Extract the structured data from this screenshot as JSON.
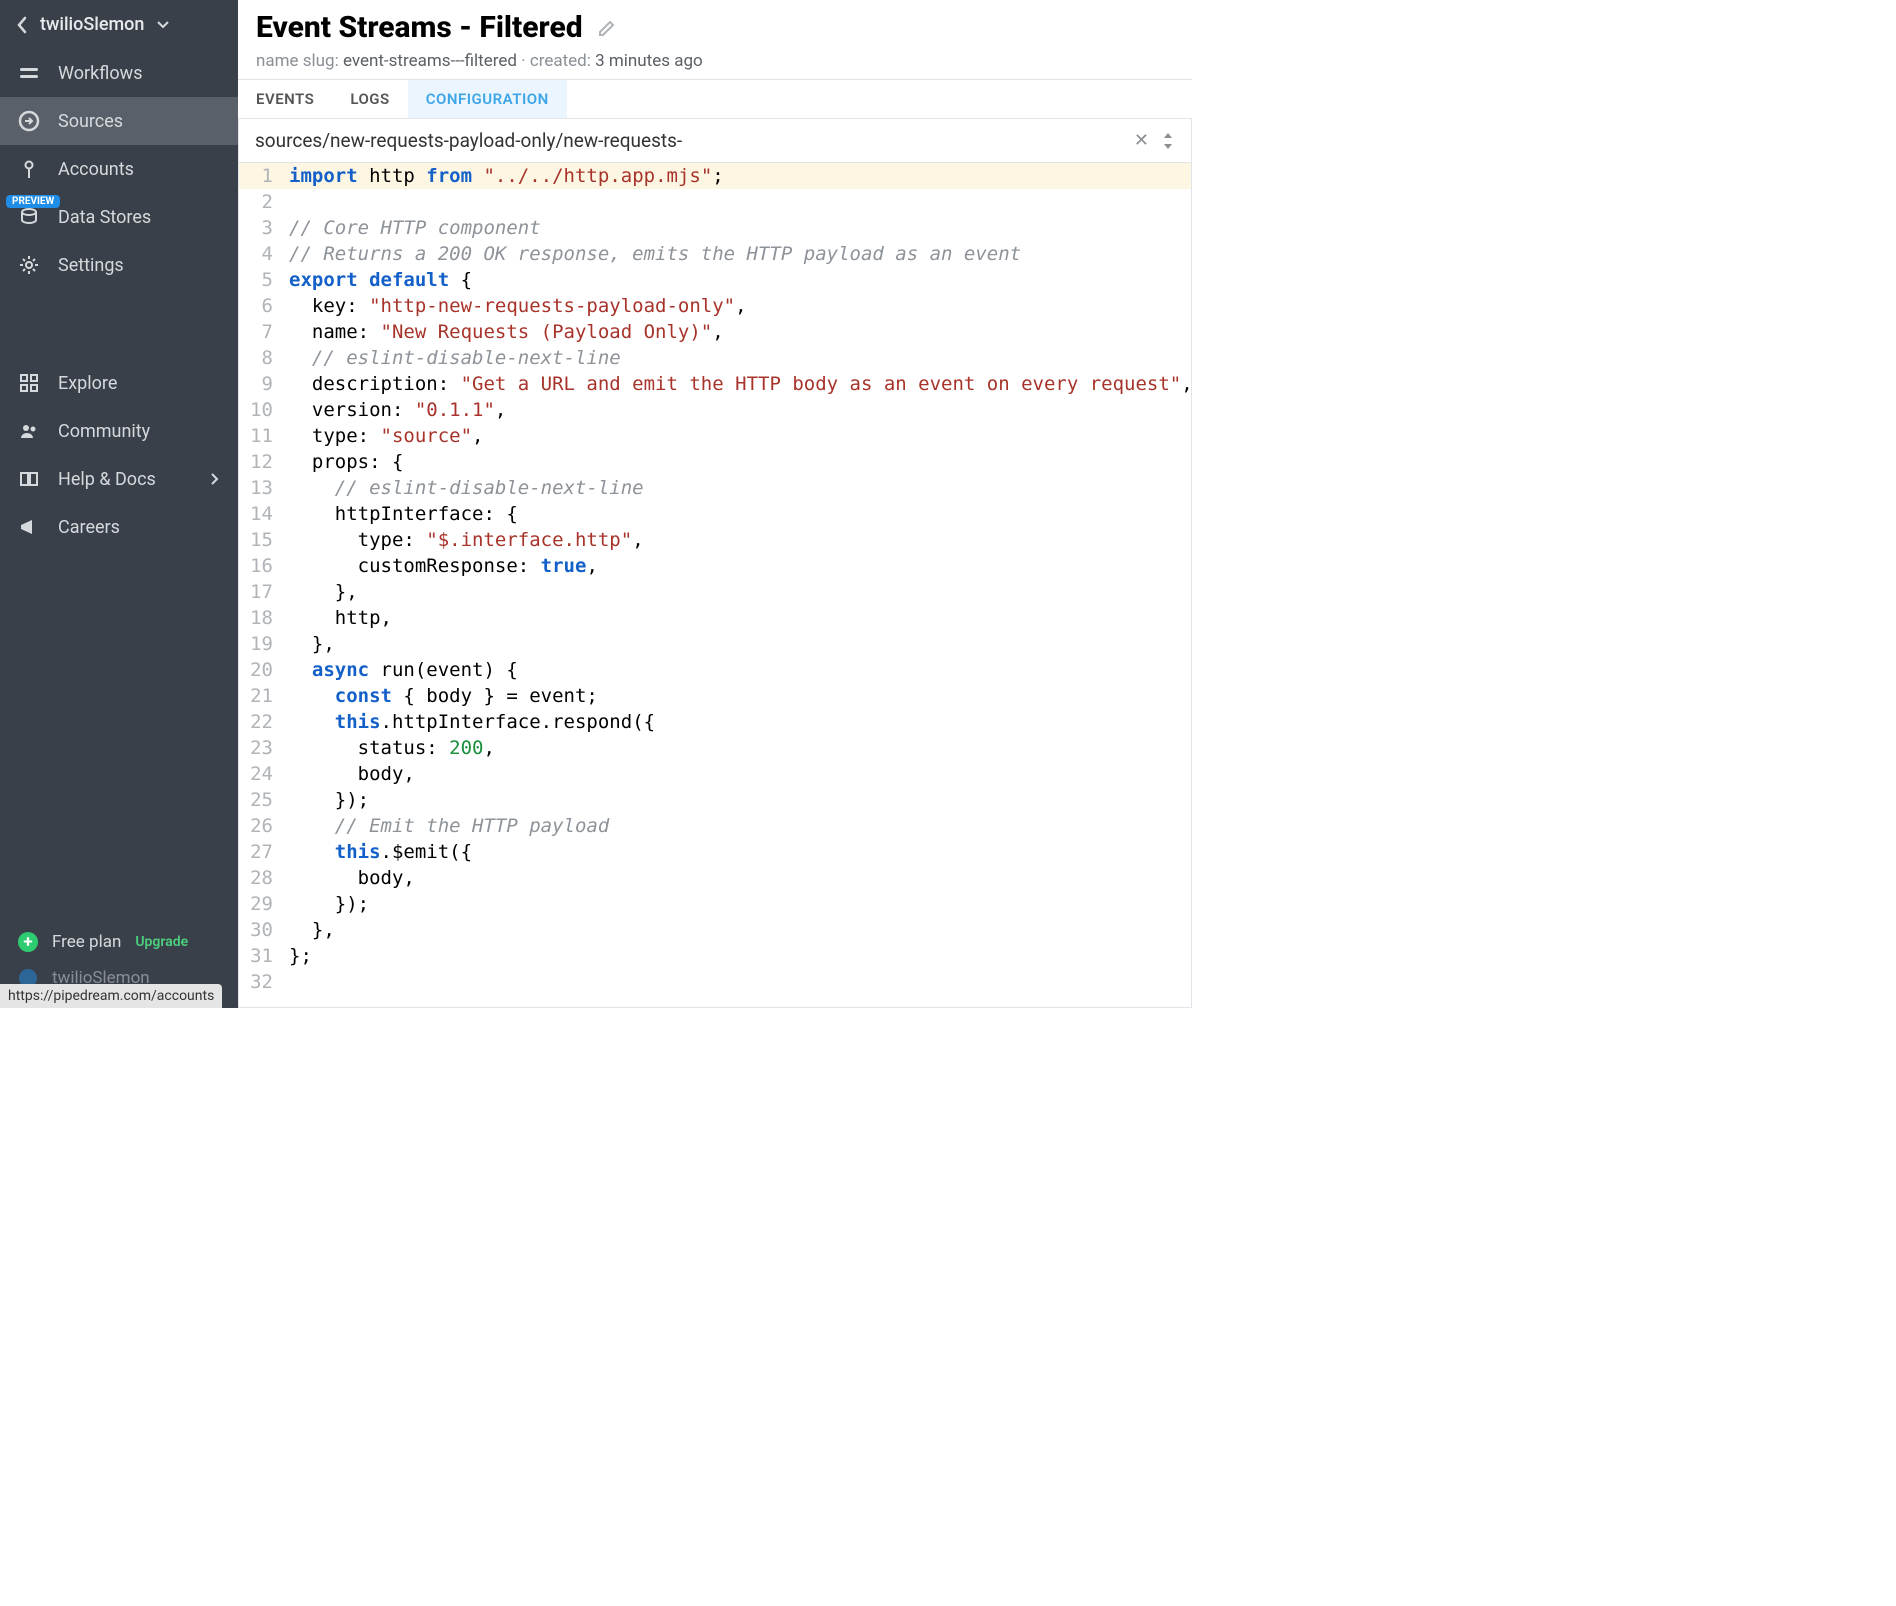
{
  "sidebar": {
    "workspace": "twilioSlemon",
    "items": [
      {
        "label": "Workflows"
      },
      {
        "label": "Sources"
      },
      {
        "label": "Accounts"
      },
      {
        "label": "Data Stores",
        "badge": "PREVIEW"
      },
      {
        "label": "Settings"
      }
    ],
    "items2": [
      {
        "label": "Explore"
      },
      {
        "label": "Community"
      },
      {
        "label": "Help & Docs"
      },
      {
        "label": "Careers"
      }
    ],
    "footer": {
      "plan": "Free plan",
      "upgrade": "Upgrade",
      "user": "twilioSlemon"
    }
  },
  "header": {
    "title": "Event Streams - Filtered",
    "slug_label": "name slug:",
    "slug": "event-streams---filtered",
    "created_label": "created:",
    "created": "3 minutes ago"
  },
  "tabs": {
    "events": "EVENTS",
    "logs": "LOGS",
    "configuration": "CONFIGURATION"
  },
  "path": "sources/new-requests-payload-only/new-requests-",
  "code": {
    "l1_import": "import",
    "l1_http": " http ",
    "l1_from": "from",
    "l1_str": " \"../../http.app.mjs\"",
    "l1_semi": ";",
    "l3": "// Core HTTP component",
    "l4": "// Returns a 200 OK response, emits the HTTP payload as an event",
    "l5_export": "export",
    "l5_sp": " ",
    "l5_default": "default",
    "l5_brace": " {",
    "l6_key": "  key: ",
    "l6_str": "\"http-new-requests-payload-only\"",
    "l6_c": ",",
    "l7_key": "  name: ",
    "l7_str": "\"New Requests (Payload Only)\"",
    "l7_c": ",",
    "l8": "  // eslint-disable-next-line",
    "l9_key": "  description: ",
    "l9_str": "\"Get a URL and emit the HTTP body as an event on every request\"",
    "l9_c": ",",
    "l10_key": "  version: ",
    "l10_str": "\"0.1.1\"",
    "l10_c": ",",
    "l11_key": "  type: ",
    "l11_str": "\"source\"",
    "l11_c": ",",
    "l12": "  props: {",
    "l13": "    // eslint-disable-next-line",
    "l14": "    httpInterface: {",
    "l15_key": "      type: ",
    "l15_str": "\"$.interface.http\"",
    "l15_c": ",",
    "l16_key": "      customResponse: ",
    "l16_bool": "true",
    "l16_c": ",",
    "l17": "    },",
    "l18": "    http,",
    "l19": "  },",
    "l20_async": "  async",
    "l20_rest": " run(event) {",
    "l21_pre": "    ",
    "l21_const": "const",
    "l21_rest": " { body } = event;",
    "l22_pre": "    ",
    "l22_this": "this",
    "l22_rest": ".httpInterface.respond({",
    "l23_pre": "      status: ",
    "l23_num": "200",
    "l23_c": ",",
    "l24": "      body,",
    "l25": "    });",
    "l26": "    // Emit the HTTP payload",
    "l27_pre": "    ",
    "l27_this": "this",
    "l27_rest": ".$emit({",
    "l28": "      body,",
    "l29": "    });",
    "l30": "  },",
    "l31": "};"
  },
  "gutter": [
    "1",
    "2",
    "3",
    "4",
    "5",
    "6",
    "7",
    "8",
    "9",
    "10",
    "11",
    "12",
    "13",
    "14",
    "15",
    "16",
    "17",
    "18",
    "19",
    "20",
    "21",
    "22",
    "23",
    "24",
    "25",
    "26",
    "27",
    "28",
    "29",
    "30",
    "31",
    "32"
  ],
  "url_preview": "https://pipedream.com/accounts"
}
